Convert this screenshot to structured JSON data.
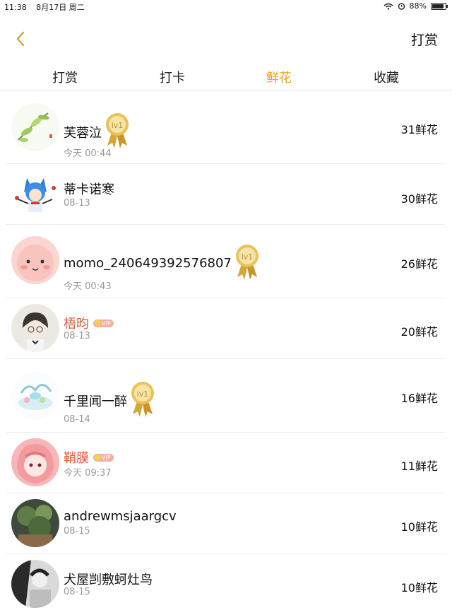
{
  "status": {
    "time": "11:38",
    "date": "8月17日 周二",
    "battery": "88%"
  },
  "header": {
    "title": "打赏"
  },
  "tabs": [
    {
      "label": "打赏",
      "active": false
    },
    {
      "label": "打卡",
      "active": false
    },
    {
      "label": "鲜花",
      "active": true
    },
    {
      "label": "收藏",
      "active": false
    }
  ],
  "badges": {
    "medal": "lv1",
    "vip": "VIP"
  },
  "colors": {
    "accent": "#f5a01a",
    "vip_name": "#e05a3a"
  },
  "rows": [
    {
      "name": "芙蓉泣",
      "date": "今天 00:44",
      "amount": "31鲜花",
      "badge": "medal"
    },
    {
      "name": "蒂卡诺寒",
      "date": "08-13",
      "amount": "30鲜花",
      "badge": "none"
    },
    {
      "name": "momo_240649392576807",
      "date": "今天 00:43",
      "amount": "26鲜花",
      "badge": "medal"
    },
    {
      "name": "梧昀",
      "date": "08-13",
      "amount": "20鲜花",
      "badge": "vip"
    },
    {
      "name": "千里闻一醉",
      "date": "08-14",
      "amount": "16鲜花",
      "badge": "medal"
    },
    {
      "name": "鞘膜",
      "date": "今天 09:37",
      "amount": "11鲜花",
      "badge": "vip"
    },
    {
      "name": "andrewmsjaargcv",
      "date": "08-15",
      "amount": "10鲜花",
      "badge": "none"
    },
    {
      "name": "犬屋剀敷蚵灶鸟",
      "date": "08-15",
      "amount": "10鲜花",
      "badge": "none"
    }
  ]
}
